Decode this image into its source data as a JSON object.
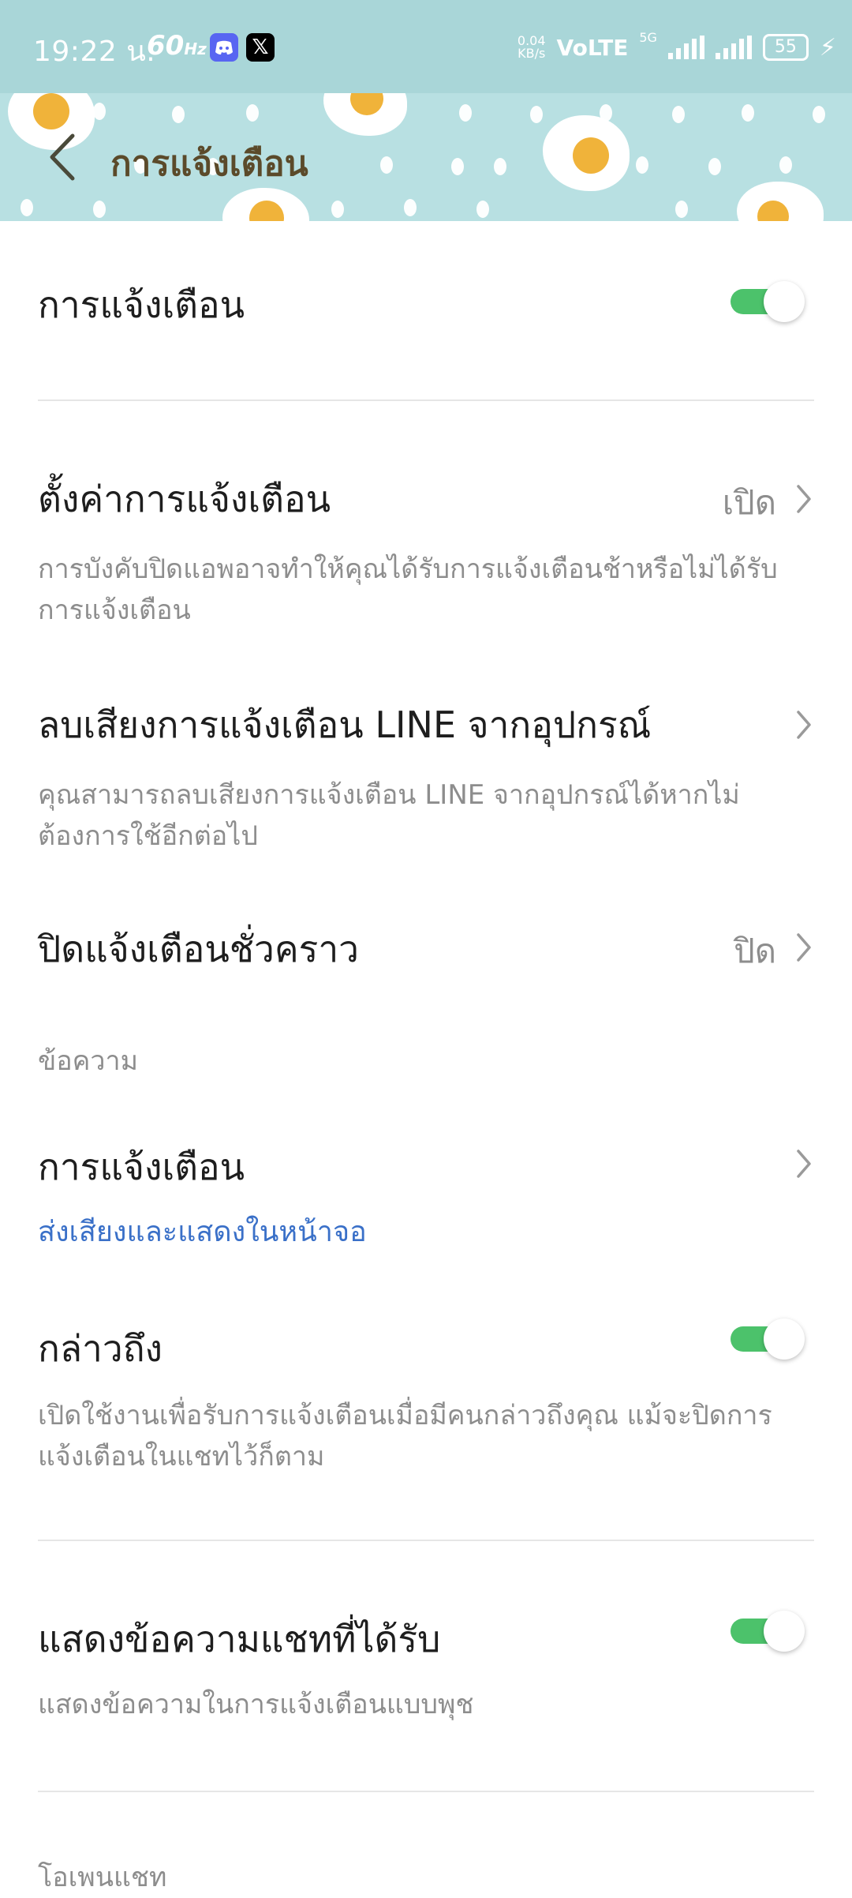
{
  "status_bar": {
    "time": "19:22 น.",
    "refresh_rate": "60",
    "refresh_unit": "Hz",
    "net_speed_value": "0.04",
    "net_speed_unit": "KB/s",
    "volte": "VoLTE",
    "network_type": "5G",
    "battery": "55",
    "app_icons": [
      "discord-icon",
      "x-icon"
    ]
  },
  "header": {
    "title": "การแจ้งเตือน"
  },
  "notifications": {
    "label": "การแจ้งเตือน",
    "enabled": true
  },
  "notification_settings": {
    "label": "ตั้งค่าการแจ้งเตือน",
    "value": "เปิด",
    "description": "การบังคับปิดแอพอาจทำให้คุณได้รับการแจ้งเตือนช้าหรือไม่ได้รับการแจ้งเตือน"
  },
  "delete_sound": {
    "label": "ลบเสียงการแจ้งเตือน LINE จากอุปกรณ์",
    "description": "คุณสามารถลบเสียงการแจ้งเตือน LINE จากอุปกรณ์ได้หากไม่ต้องการใช้อีกต่อไป"
  },
  "temp_mute": {
    "label": "ปิดแจ้งเตือนชั่วคราว",
    "value": "ปิด"
  },
  "messages_section": {
    "header": "ข้อความ",
    "notification_label": "การแจ้งเตือน",
    "notification_value": "ส่งเสียงและแสดงในหน้าจอ"
  },
  "mentions": {
    "label": "กล่าวถึง",
    "enabled": true,
    "description": "เปิดใช้งานเพื่อรับการแจ้งเตือนเมื่อมีคนกล่าวถึงคุณ แม้จะปิดการแจ้งเตือนในแชทไว้ก็ตาม"
  },
  "show_message": {
    "label": "แสดงข้อความแชทที่ได้รับ",
    "enabled": true,
    "description": "แสดงข้อความในการแจ้งเตือนแบบพุช"
  },
  "open_chat_section": {
    "header": "โอเพนแชท"
  },
  "colors": {
    "toggle_on": "#4cc26b",
    "link_blue": "#3a70c8",
    "header_bg": "#b8e0e2",
    "status_bar_bg": "#a9d6d8"
  }
}
